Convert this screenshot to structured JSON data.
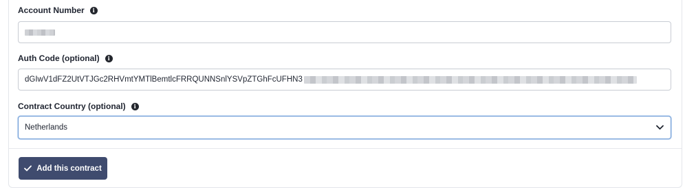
{
  "form": {
    "account_number": {
      "label": "Account Number",
      "info_icon": "info-icon",
      "value_masked": true
    },
    "auth_code": {
      "label": "Auth Code (optional)",
      "info_icon": "info-icon",
      "visible_value": "dGIwV1dFZ2UtVTJGc2RHVmtYMTlBemtlcFRRQUNNSnlYSVpZTGhFcUFHN3",
      "value_partially_masked": true
    },
    "contract_country": {
      "label": "Contract Country (optional)",
      "info_icon": "info-icon",
      "selected": "Netherlands",
      "dropdown_icon": "chevron-down-icon"
    },
    "submit": {
      "label": "Add this contract",
      "icon": "check-icon"
    }
  },
  "colors": {
    "button_bg": "#3f4b6e",
    "focus_border": "#6d9bd6",
    "input_border": "#c8ccd3",
    "text": "#1f2430"
  }
}
